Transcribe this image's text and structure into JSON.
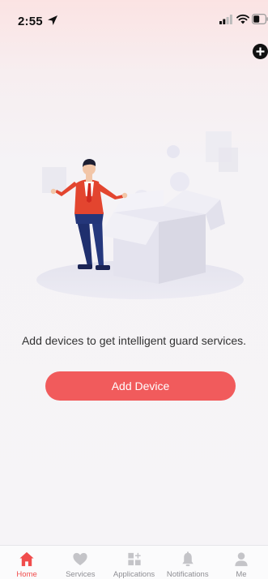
{
  "status_bar": {
    "time": "2:55"
  },
  "header": {
    "add_icon": "plus-circle-icon"
  },
  "empty_state": {
    "illustration": "person-with-open-box-illustration",
    "message": "Add devices to get intelligent guard services.",
    "button_label": "Add Device"
  },
  "tabs": [
    {
      "label": "Home",
      "icon": "home-icon",
      "active": true
    },
    {
      "label": "Services",
      "icon": "heart-icon",
      "active": false
    },
    {
      "label": "Applications",
      "icon": "apps-grid-icon",
      "active": false
    },
    {
      "label": "Notifications",
      "icon": "bell-icon",
      "active": false
    },
    {
      "label": "Me",
      "icon": "person-icon",
      "active": false
    }
  ],
  "colors": {
    "accent": "#f15b5c",
    "active_tab": "#f04c4c",
    "inactive_tab": "#c4c4c8"
  }
}
